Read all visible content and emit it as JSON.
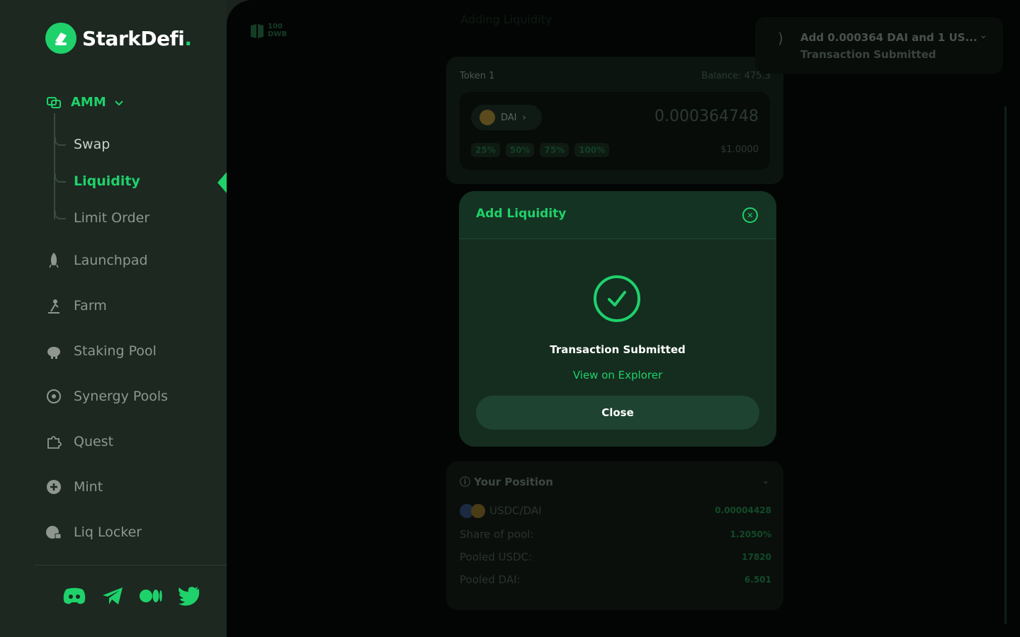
{
  "brand": {
    "name": "StarkDefi",
    "dot": ".",
    "accent": "#1fd16b"
  },
  "nav": {
    "amm": "AMM",
    "sub": {
      "swap": "Swap",
      "liquidity": "Liquidity",
      "limit": "Limit Order"
    },
    "items": {
      "launchpad": "Launchpad",
      "farm": "Farm",
      "staking": "Staking Pool",
      "synergy": "Synergy Pools",
      "quest": "Quest",
      "mint": "Mint",
      "locker": "Liq Locker"
    }
  },
  "socials": [
    "discord-icon",
    "telegram-icon",
    "medium-icon",
    "twitter-icon"
  ],
  "background": {
    "top_logo_num": "100",
    "top_logo_text": "DWB",
    "heading": "Adding Liquidity",
    "token_label": "Token 1",
    "balance": "Balance: 475.3",
    "token": "DAI",
    "amount": "0.000364748",
    "percents": [
      "25%",
      "50%",
      "75%",
      "100%"
    ],
    "usd": "$1.0000",
    "position": {
      "title": "Your Position",
      "pair": "USDC/DAI",
      "pair_value": "0.00004428",
      "share_label": "Share of pool:",
      "share_value": "1.2050%",
      "usdc_label": "Pooled USDC:",
      "usdc_value": "17820",
      "dai_label": "Pooled DAI:",
      "dai_value": "6.501"
    }
  },
  "toast": {
    "title": "Add 0.000364 DAI and 1 US...",
    "subtitle": "Transaction Submitted"
  },
  "modal": {
    "title": "Add Liquidity",
    "status": "Transaction Submitted",
    "link": "View on Explorer",
    "close": "Close"
  }
}
